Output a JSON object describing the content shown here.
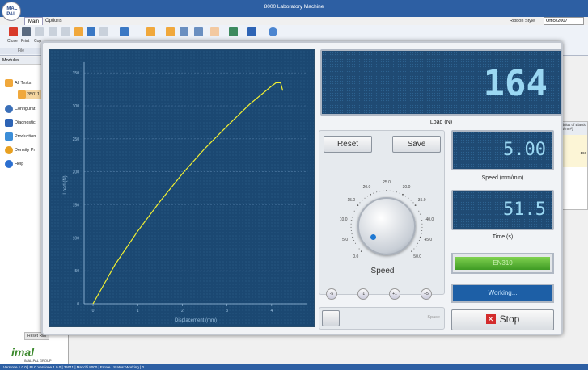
{
  "app": {
    "title": "8000 Laboratory Machine",
    "logo_text": "IMAL PAL"
  },
  "tabs": {
    "main": "Main",
    "options": "Options"
  },
  "ribbon": {
    "style_label": "Ribbon Style",
    "style_value": "Office2007",
    "close_label": "Close",
    "print_label": "Print",
    "copy_label": "Cop",
    "file_group": "File"
  },
  "sidebar": {
    "header": "Modules",
    "items": [
      {
        "label": "All Tests"
      },
      {
        "label": "35011"
      },
      {
        "label": "Configurat"
      },
      {
        "label": "Diagnostic"
      },
      {
        "label": "Production"
      },
      {
        "label": "Density Pr"
      },
      {
        "label": "Help"
      }
    ],
    "reset_label": "Reset Ribl",
    "company_logo": "imal",
    "company_sub": "IMAL-PAL GROUP"
  },
  "background_table": {
    "header": "odulus of Elastic",
    "unit": "(N/mm²)",
    "value": "160"
  },
  "status_bar": "Versione 1.0.0 | PLC Versione 1.0.0 | 35011 | Macchi 8000 | Errore | Status: Working | 0",
  "chart_data": {
    "type": "line",
    "xlabel": "Displacement (mm)",
    "ylabel": "Load (N)",
    "xlim": [
      -0.2,
      4.8
    ],
    "ylim": [
      0,
      360
    ],
    "xticks": [
      0,
      1,
      2,
      3,
      4
    ],
    "yticks": [
      0,
      50,
      100,
      150,
      200,
      250,
      300,
      350
    ],
    "grid": "horizontal",
    "series": [
      {
        "color": "#f2f032",
        "x": [
          0,
          0.5,
          1.0,
          1.5,
          2.0,
          2.5,
          3.0,
          3.5,
          4.0,
          4.1,
          4.2,
          4.25
        ],
        "y": [
          0,
          60,
          110,
          155,
          197,
          235,
          269,
          302,
          330,
          335,
          335,
          323
        ]
      }
    ]
  },
  "readouts": {
    "load_value": "164",
    "load_label": "Load (N)",
    "speed_value": "5.00",
    "speed_label": "Speed (mm/min)",
    "time_value": "51.5",
    "time_label": "Time (s)"
  },
  "controls": {
    "reset": "Reset",
    "save": "Save",
    "speed_title": "Speed",
    "dial_ticks": [
      "0.0",
      "5.0",
      "10.0",
      "15.0",
      "20.0",
      "25.0",
      "30.0",
      "35.0",
      "40.0",
      "45.0",
      "50.0"
    ],
    "dial_value": 5.0,
    "step_buttons": [
      "-5",
      "-1",
      "+1",
      "+5"
    ],
    "space_label": "Space",
    "stop_label": "Stop",
    "device_indicator": "EN310",
    "status_indicator": "Working..."
  },
  "colors": {
    "accent": "#2d5fa3",
    "display_bg": "#1f4a73",
    "display_text": "#9ad7f2",
    "curve": "#f2f032",
    "stop": "#d32c2c",
    "indicator_green": "#5cbf38"
  }
}
